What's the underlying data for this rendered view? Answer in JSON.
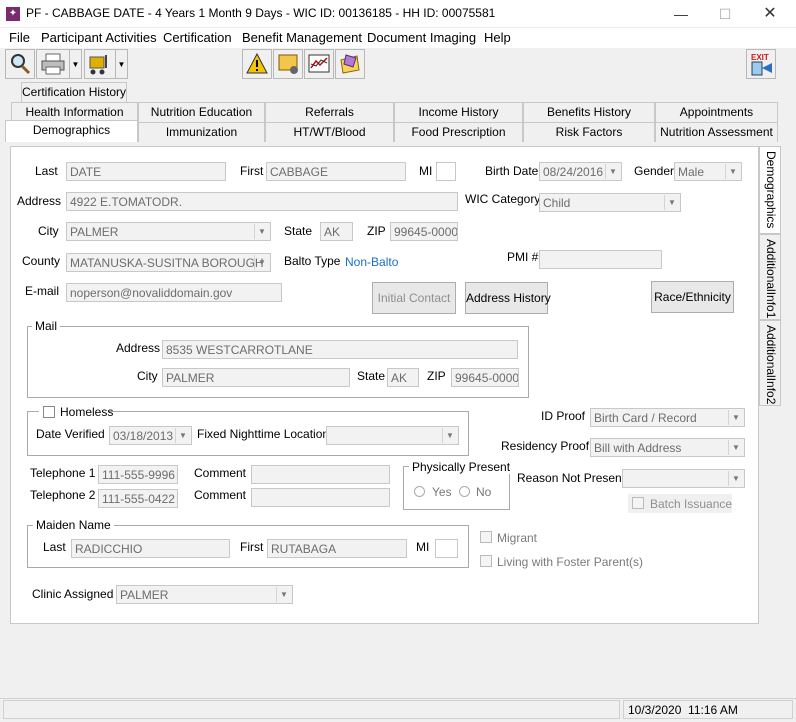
{
  "window": {
    "title": "PF - CABBAGE DATE - 4 Years 1 Month 9 Days - WIC ID: 00136185 - HH ID: 00075581",
    "minimize": "—",
    "maximize": "☐",
    "close": "✕"
  },
  "menu": {
    "items": [
      "File",
      "Participant Activities",
      "Certification",
      "Benefit Management",
      "Document Imaging",
      "Help"
    ]
  },
  "toolbar": {
    "exit_label": "EXIT"
  },
  "tabs": {
    "row0": [
      "Certification History"
    ],
    "row1": [
      "Health Information",
      "Nutrition Education",
      "Referrals",
      "Income History",
      "Benefits History",
      "Appointments"
    ],
    "row2": [
      "Demographics",
      "Immunization",
      "HT/WT/Blood",
      "Food Prescription",
      "Risk Factors",
      "Nutrition Assessment"
    ]
  },
  "side_tabs": [
    "Demographics",
    "AdditionalInfo1",
    "AdditionalInfo2"
  ],
  "form": {
    "last_label": "Last",
    "last": "DATE",
    "first_label": "First",
    "first": "CABBAGE",
    "mi_label": "MI",
    "mi": "",
    "birth_date_label": "Birth Date",
    "birth_date": "08/24/2016",
    "gender_label": "Gender",
    "gender": "Male",
    "address_label": "Address",
    "address": "4922 E.TOMATODR.",
    "wic_category_label": "WIC Category",
    "wic_category": "Child",
    "city_label": "City",
    "city": "PALMER",
    "state_label": "State",
    "state": "AK",
    "zip_label": "ZIP",
    "zip": "99645-0000",
    "county_label": "County",
    "county": "MATANUSKA-SUSITNA BOROUGH",
    "balto_type_label": "Balto Type",
    "balto_type": "Non-Balto",
    "pmi_label": "PMI #",
    "pmi": "",
    "email_label": "E-mail",
    "email": "noperson@novaliddomain.gov",
    "initial_contact_button": "Initial Contact",
    "address_history_button": "Address History",
    "race_ethnicity_button": "Race/Ethnicity"
  },
  "mail": {
    "legend": "Mail",
    "address_label": "Address",
    "address": "8535 WESTCARROTLANE",
    "city_label": "City",
    "city": "PALMER",
    "state_label": "State",
    "state": "AK",
    "zip_label": "ZIP",
    "zip": "99645-0000"
  },
  "homeless": {
    "label": "Homeless",
    "date_verified_label": "Date Verified",
    "date_verified": "03/18/2013",
    "fixed_nighttime_label": "Fixed Nighttime Location",
    "fixed_nighttime": ""
  },
  "proofs": {
    "id_proof_label": "ID Proof",
    "id_proof": "Birth Card / Record",
    "residency_proof_label": "Residency Proof",
    "residency_proof": "Bill with Address",
    "reason_not_present_label": "Reason Not Present",
    "reason_not_present": "",
    "batch_issuance_label": "Batch Issuance"
  },
  "phones": {
    "telephone1_label": "Telephone 1",
    "telephone1": "111-555-9996",
    "telephone2_label": "Telephone 2",
    "telephone2": "111-555-0422",
    "comment_label": "Comment",
    "comment1": "",
    "comment2": ""
  },
  "physically_present": {
    "legend": "Physically Present",
    "yes_label": "Yes",
    "no_label": "No"
  },
  "maiden": {
    "legend": "Maiden Name",
    "last_label": "Last",
    "last": "RADICCHIO",
    "first_label": "First",
    "first": "RUTABAGA",
    "mi_label": "MI",
    "mi": ""
  },
  "checks": {
    "migrant_label": "Migrant",
    "foster_label": "Living with Foster Parent(s)"
  },
  "clinic": {
    "label": "Clinic Assigned",
    "value": "PALMER"
  },
  "status": {
    "datetime": "10/3/2020  11:16 AM"
  },
  "colors": {
    "link": "#1a6fc0",
    "app_icon": "#7a2a6e",
    "exit_red": "#d01818"
  }
}
